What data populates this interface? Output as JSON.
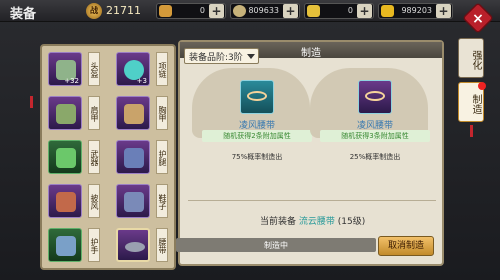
{
  "header": {
    "title": "装备",
    "power": "21711"
  },
  "currencies": [
    {
      "icon": "star-coin-icon",
      "value": "0",
      "color": "#d49a3a"
    },
    {
      "icon": "silver-coin-icon",
      "value": "809633",
      "color": "#c7b27a"
    },
    {
      "icon": "gold-ingot-icon",
      "value": "0",
      "color": "#e6c13a"
    },
    {
      "icon": "gold-bar-icon",
      "value": "989203",
      "color": "#e8b820"
    }
  ],
  "side_tabs": [
    {
      "label": "强化"
    },
    {
      "label": "制造"
    }
  ],
  "slots": [
    {
      "label": "头盔",
      "count": "+32",
      "color": "#8fb38a"
    },
    {
      "label": "项链",
      "count": "+3",
      "color": "#4fd0c8"
    },
    {
      "label": "肩甲",
      "count": "",
      "color": "#8aa86a"
    },
    {
      "label": "胸甲",
      "count": "",
      "color": "#c9a36a"
    },
    {
      "label": "武器",
      "count": "",
      "color": "#6bc86a"
    },
    {
      "label": "护腿",
      "count": "",
      "color": "#6a7fb8"
    },
    {
      "label": "披风",
      "count": "",
      "color": "#c2694a"
    },
    {
      "label": "鞋子",
      "count": "",
      "color": "#7a8ab8"
    },
    {
      "label": "护手",
      "count": "",
      "color": "#7aa0c8"
    },
    {
      "label": "腰带",
      "count": "",
      "color": "#9aa0b0"
    }
  ],
  "panel": {
    "title": "制造",
    "grade": "装备品阶:3阶",
    "cards": [
      {
        "name": "凌风腰带",
        "attr": "随机获得2条附加属性",
        "rate": "75%概率制造出"
      },
      {
        "name": "凌风腰带",
        "attr": "随机获得3条附加属性",
        "rate": "25%概率制造出"
      }
    ],
    "current_label": "当前装备",
    "current_name": "流云腰带",
    "current_level": "(15级)",
    "progress_label": "制造中",
    "cancel_label": "取消制造"
  }
}
